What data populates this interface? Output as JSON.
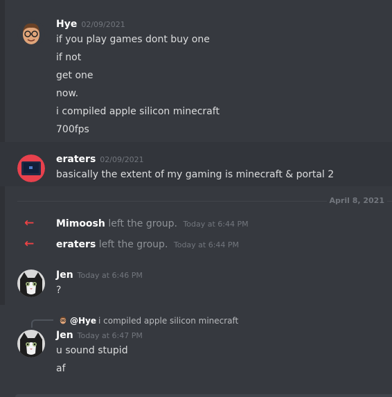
{
  "messages": [
    {
      "author": "Hye",
      "timestamp": "02/09/2021",
      "avatar_icon": "memoji-avatar",
      "lines": [
        "if you play games dont buy one",
        "if not",
        "get one",
        "now.",
        "i compiled apple silicon minecraft",
        "700fps"
      ]
    },
    {
      "author": "eraters",
      "timestamp": "02/09/2021",
      "avatar_icon": "laptop-avatar",
      "lines": [
        "basically the extent of my gaming is minecraft & portal 2"
      ]
    }
  ],
  "date_divider": "April 8, 2021",
  "system_events": [
    {
      "name": "Mimoosh",
      "text": "left the group.",
      "timestamp": "Today at 6:44 PM"
    },
    {
      "name": "eraters",
      "text": "left the group.",
      "timestamp": "Today at 6:44 PM"
    }
  ],
  "jen_message_1": {
    "author": "Jen",
    "timestamp": "Today at 6:46 PM",
    "avatar_icon": "cat-avatar",
    "lines": [
      "?"
    ]
  },
  "reply": {
    "mention": "@Hye",
    "quoted": "i compiled apple silicon minecraft"
  },
  "jen_message_2": {
    "author": "Jen",
    "timestamp": "Today at 6:47 PM",
    "avatar_icon": "cat-avatar",
    "lines": [
      "u sound stupid",
      "af"
    ]
  },
  "colors": {
    "background": "#36393f",
    "system_arrow": "#ed4245",
    "username": "#ffffff",
    "timestamp": "#72767d"
  }
}
